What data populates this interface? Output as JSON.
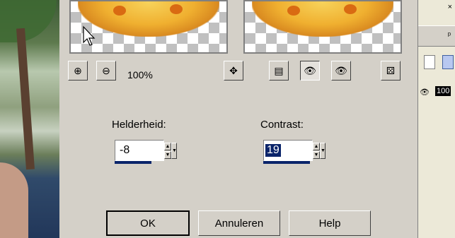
{
  "dialog": {
    "zoom_level": "100%",
    "fields": {
      "brightness": {
        "label": "Helderheid:",
        "value": "-8"
      },
      "contrast": {
        "label": "Contrast:",
        "value": "19"
      }
    },
    "buttons": {
      "ok": "OK",
      "cancel": "Annuleren",
      "help": "Help"
    }
  },
  "right_panel": {
    "opacity_value": "100"
  },
  "colors": {
    "selection": "#0a246a",
    "dialog_bg": "#d4d0c8"
  }
}
